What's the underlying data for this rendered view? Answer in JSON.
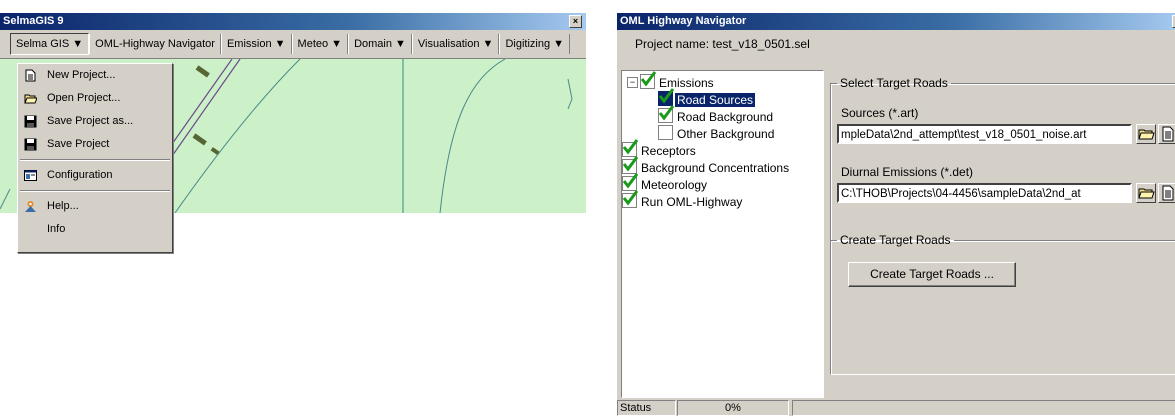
{
  "selma": {
    "title": "SelmaGIS 9",
    "close": "×",
    "menus": [
      "Selma GIS ▼",
      "OML-Highway Navigator",
      "Emission ▼",
      "Meteo ▼",
      "Domain ▼",
      "Visualisation ▼",
      "Digitizing ▼"
    ],
    "dropdown": {
      "items": [
        "New Project...",
        "Open Project...",
        "Save Project as...",
        "Save Project",
        "Configuration",
        "Help...",
        "Info"
      ]
    }
  },
  "oml": {
    "title": "OML Highway Navigator",
    "close": "×",
    "project_label": "Project name: test_v18_0501.sel",
    "tree": {
      "expander": "−",
      "items": [
        "Emissions",
        "Road Sources",
        "Road Background",
        "Other Background",
        "Receptors",
        "Background Concentrations",
        "Meteorology",
        "Run OML-Highway"
      ]
    },
    "select_group": {
      "legend": "Select Target Roads",
      "sources_label": "Sources (*.art)",
      "sources_value": "mpleData\\2nd_attempt\\test_v18_0501_noise.art",
      "diurnal_label": "Diurnal Emissions (*.det)",
      "diurnal_value": "C:\\THOB\\Projects\\04-4456\\sampleData\\2nd_at"
    },
    "create_group": {
      "legend": "Create Target Roads",
      "button": "Create Target Roads ..."
    },
    "status": {
      "label": "Status",
      "progress": "0%"
    }
  }
}
